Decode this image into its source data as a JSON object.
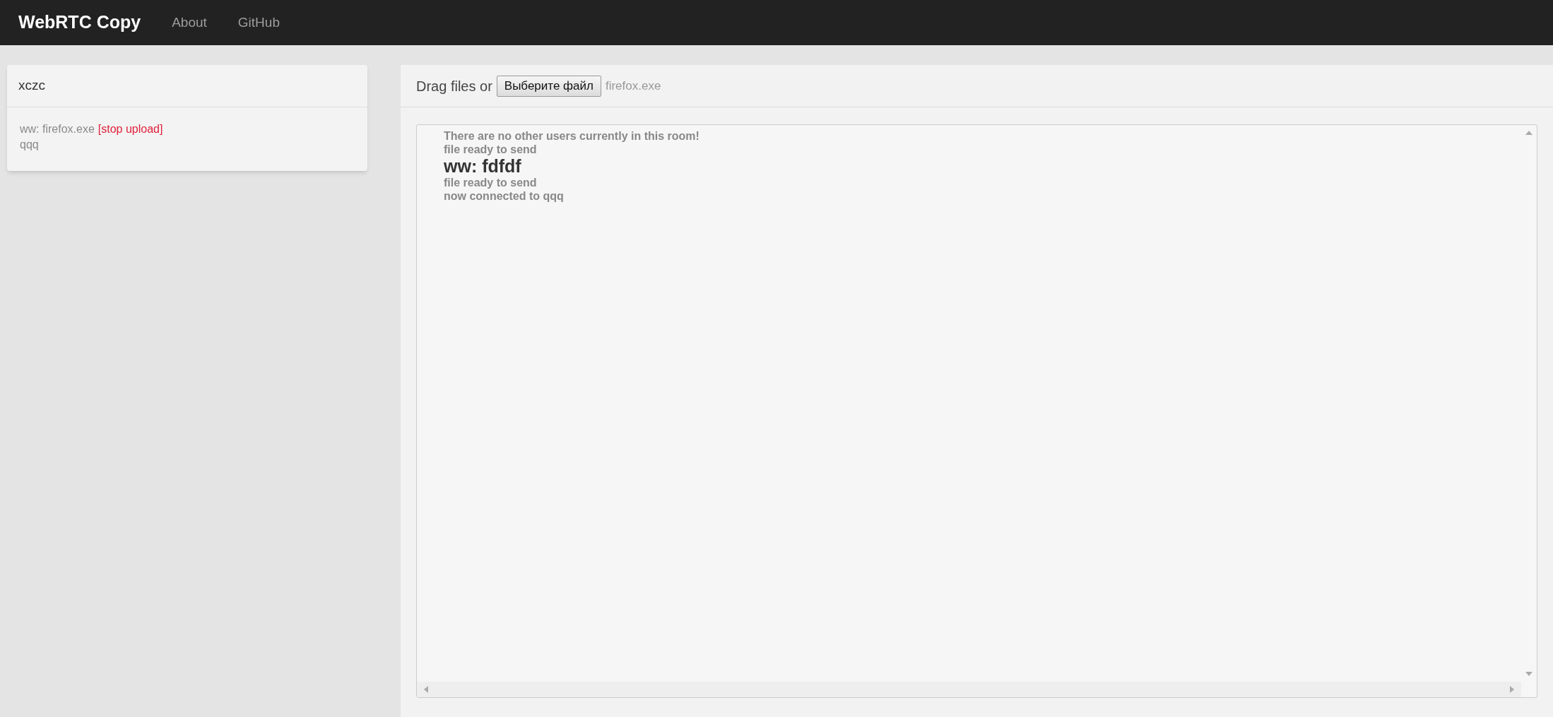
{
  "navbar": {
    "brand": "WebRTC Copy",
    "links": [
      "About",
      "GitHub"
    ]
  },
  "room": {
    "title": "xczc",
    "entries": [
      {
        "kind": "upload",
        "text": "ww: firefox.exe",
        "action": "[stop upload]"
      },
      {
        "kind": "user",
        "text": "qqq"
      }
    ]
  },
  "upload": {
    "prompt": "Drag files or",
    "button": "Выберите файл",
    "file_name": "firefox.exe"
  },
  "messages": [
    {
      "kind": "status",
      "text": "There are no other users currently in this room!"
    },
    {
      "kind": "status",
      "text": "file ready to send"
    },
    {
      "kind": "chat",
      "text": "ww: fdfdf"
    },
    {
      "kind": "status",
      "text": "file ready to send"
    },
    {
      "kind": "status",
      "text": "now connected to qqq"
    }
  ]
}
